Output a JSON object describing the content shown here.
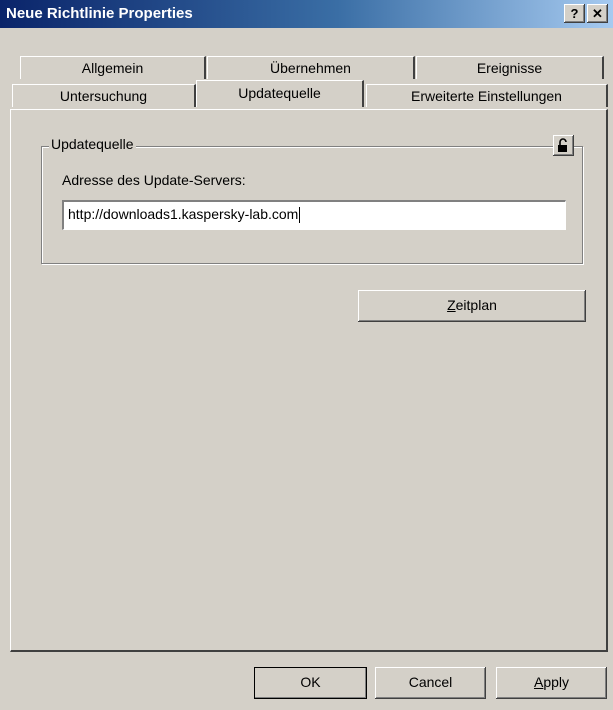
{
  "window": {
    "title": "Neue Richtlinie Properties",
    "help_glyph": "?",
    "close_glyph": "✕"
  },
  "tabs": {
    "row1": [
      {
        "label": "Allgemein"
      },
      {
        "label": "Übernehmen"
      },
      {
        "label": "Ereignisse"
      }
    ],
    "row2": [
      {
        "label": "Untersuchung"
      },
      {
        "label": "Updatequelle",
        "active": true
      },
      {
        "label": "Erweiterte Einstellungen"
      }
    ]
  },
  "group": {
    "legend": "Updatequelle",
    "lock_icon": "lock-open-icon",
    "server_label": "Adresse des Update-Servers:",
    "server_value": "http://downloads1.kaspersky-lab.com"
  },
  "schedule_button": {
    "prefix": "Z",
    "rest": "eitplan"
  },
  "footer": {
    "ok": "OK",
    "cancel": "Cancel",
    "apply_prefix": "A",
    "apply_rest": "pply"
  }
}
